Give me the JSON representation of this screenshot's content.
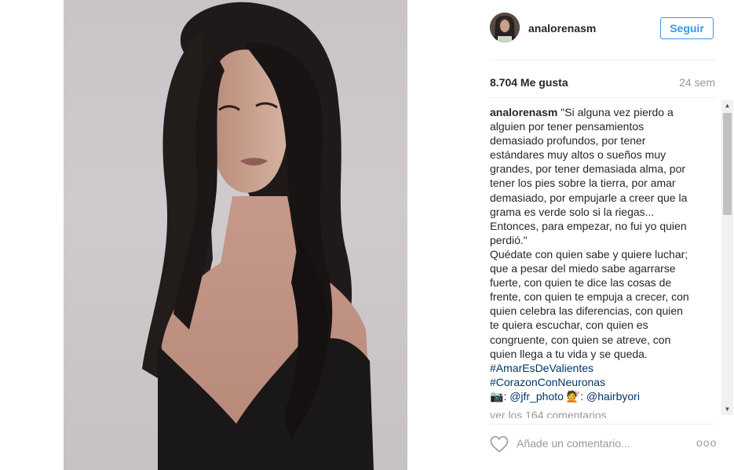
{
  "post": {
    "username": "analorenasm",
    "follow_label": "Seguir",
    "likes": "8.704 Me gusta",
    "age": "24 sem"
  },
  "caption": {
    "author": "analorenasm",
    "lines": [
      "\"Si alguna vez pierdo a",
      "alguien por tener pensamientos",
      "demasiado profundos, por tener",
      "estándares muy altos o sueños muy",
      "grandes, por tener demasiada alma, por",
      "tener los pies sobre la tierra, por amar",
      "demasiado, por empujarle a creer que la",
      "grama es verde solo si la riegas...",
      "Entonces, para empezar, no fui yo quien",
      "perdió.\"",
      "Quédate con quien sabe y quiere luchar;",
      "que a pesar del miedo sabe agarrarse",
      "fuerte, con quien te dice las cosas de",
      "frente, con quien te empuja a crecer, con",
      "quien celebra las diferencias, con quien",
      "te quiera escuchar, con quien es",
      "congruente, con quien se atreve, con",
      "quien llega a tu vida y se queda."
    ],
    "hashtags": [
      "#AmarEsDeValientes",
      "#CorazonConNeuronas"
    ],
    "credit_photo": "@jfr_photo",
    "credit_hair": "@hairbyori",
    "camera_emoji": "📷",
    "hair_emoji": "💇"
  },
  "comments": {
    "view_all": "ver los 164 comentarios"
  },
  "footer": {
    "comment_placeholder": "Añade un comentario...",
    "options": "ooo"
  },
  "icons": {
    "like": "heart-outline-icon",
    "scroll_up": "arrow-up-icon",
    "scroll_down": "arrow-down-icon"
  }
}
